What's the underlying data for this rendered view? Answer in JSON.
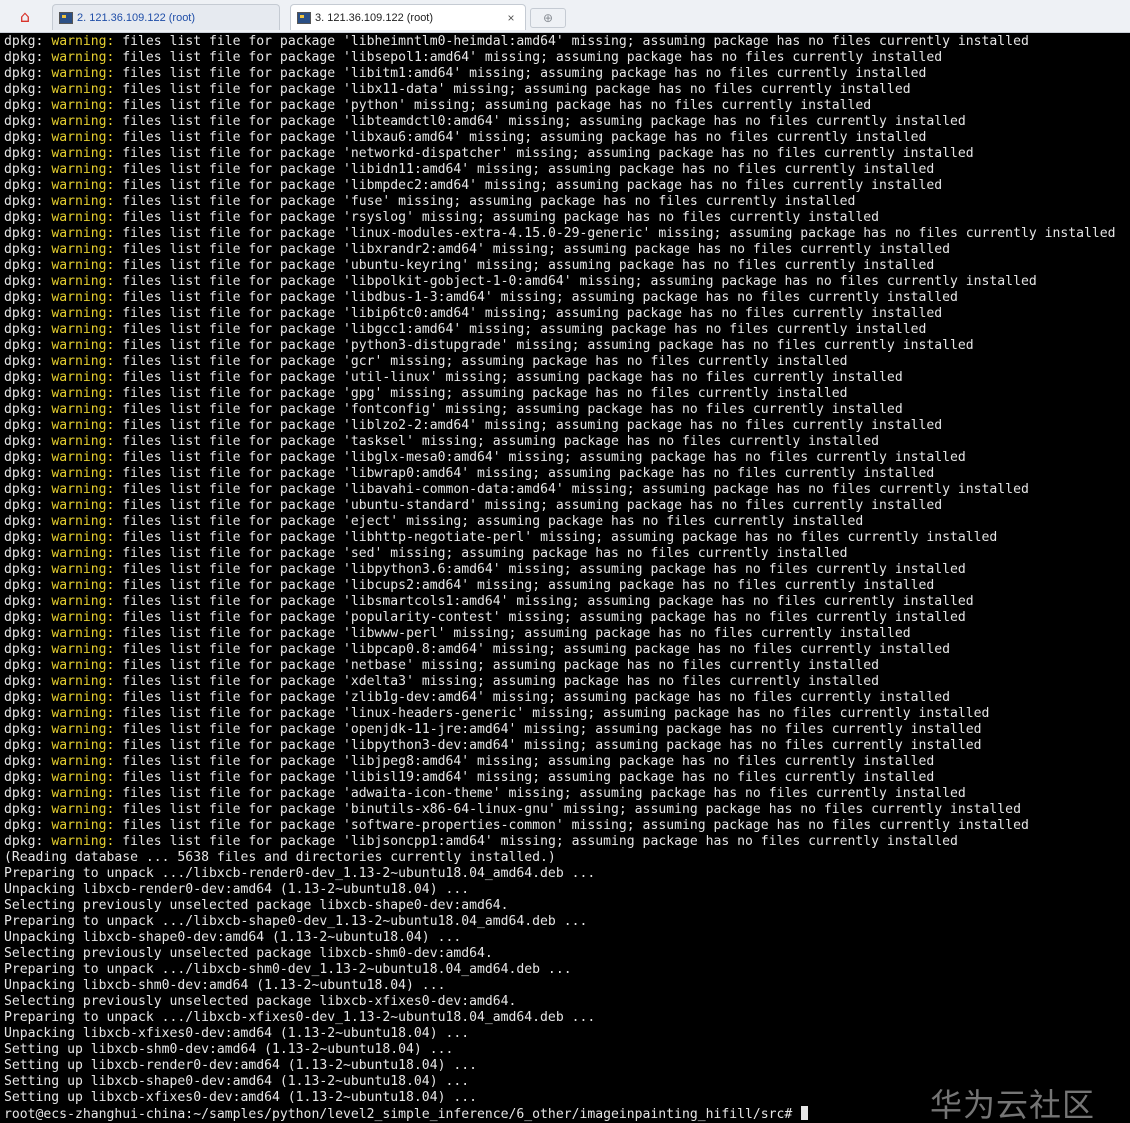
{
  "tabs": [
    {
      "label": "2. 121.36.109.122 (root)"
    },
    {
      "label": "3. 121.36.109.122 (root)",
      "close": "×"
    }
  ],
  "colors": {
    "warning": "#e5cf2f",
    "text": "#e6e6e6",
    "background": "#000000"
  },
  "warning_prefix": "dpkg: ",
  "warning_word": "warning:",
  "warning_lines": [
    " files list file for package 'libheimntlm0-heimdal:amd64' missing; assuming package has no files currently installed",
    " files list file for package 'libsepol1:amd64' missing; assuming package has no files currently installed",
    " files list file for package 'libitm1:amd64' missing; assuming package has no files currently installed",
    " files list file for package 'libx11-data' missing; assuming package has no files currently installed",
    " files list file for package 'python' missing; assuming package has no files currently installed",
    " files list file for package 'libteamdctl0:amd64' missing; assuming package has no files currently installed",
    " files list file for package 'libxau6:amd64' missing; assuming package has no files currently installed",
    " files list file for package 'networkd-dispatcher' missing; assuming package has no files currently installed",
    " files list file for package 'libidn11:amd64' missing; assuming package has no files currently installed",
    " files list file for package 'libmpdec2:amd64' missing; assuming package has no files currently installed",
    " files list file for package 'fuse' missing; assuming package has no files currently installed",
    " files list file for package 'rsyslog' missing; assuming package has no files currently installed",
    " files list file for package 'linux-modules-extra-4.15.0-29-generic' missing; assuming package has no files currently installed",
    " files list file for package 'libxrandr2:amd64' missing; assuming package has no files currently installed",
    " files list file for package 'ubuntu-keyring' missing; assuming package has no files currently installed",
    " files list file for package 'libpolkit-gobject-1-0:amd64' missing; assuming package has no files currently installed",
    " files list file for package 'libdbus-1-3:amd64' missing; assuming package has no files currently installed",
    " files list file for package 'libip6tc0:amd64' missing; assuming package has no files currently installed",
    " files list file for package 'libgcc1:amd64' missing; assuming package has no files currently installed",
    " files list file for package 'python3-distupgrade' missing; assuming package has no files currently installed",
    " files list file for package 'gcr' missing; assuming package has no files currently installed",
    " files list file for package 'util-linux' missing; assuming package has no files currently installed",
    " files list file for package 'gpg' missing; assuming package has no files currently installed",
    " files list file for package 'fontconfig' missing; assuming package has no files currently installed",
    " files list file for package 'liblzo2-2:amd64' missing; assuming package has no files currently installed",
    " files list file for package 'tasksel' missing; assuming package has no files currently installed",
    " files list file for package 'libglx-mesa0:amd64' missing; assuming package has no files currently installed",
    " files list file for package 'libwrap0:amd64' missing; assuming package has no files currently installed",
    " files list file for package 'libavahi-common-data:amd64' missing; assuming package has no files currently installed",
    " files list file for package 'ubuntu-standard' missing; assuming package has no files currently installed",
    " files list file for package 'eject' missing; assuming package has no files currently installed",
    " files list file for package 'libhttp-negotiate-perl' missing; assuming package has no files currently installed",
    " files list file for package 'sed' missing; assuming package has no files currently installed",
    " files list file for package 'libpython3.6:amd64' missing; assuming package has no files currently installed",
    " files list file for package 'libcups2:amd64' missing; assuming package has no files currently installed",
    " files list file for package 'libsmartcols1:amd64' missing; assuming package has no files currently installed",
    " files list file for package 'popularity-contest' missing; assuming package has no files currently installed",
    " files list file for package 'libwww-perl' missing; assuming package has no files currently installed",
    " files list file for package 'libpcap0.8:amd64' missing; assuming package has no files currently installed",
    " files list file for package 'netbase' missing; assuming package has no files currently installed",
    " files list file for package 'xdelta3' missing; assuming package has no files currently installed",
    " files list file for package 'zlib1g-dev:amd64' missing; assuming package has no files currently installed",
    " files list file for package 'linux-headers-generic' missing; assuming package has no files currently installed",
    " files list file for package 'openjdk-11-jre:amd64' missing; assuming package has no files currently installed",
    " files list file for package 'libpython3-dev:amd64' missing; assuming package has no files currently installed",
    " files list file for package 'libjpeg8:amd64' missing; assuming package has no files currently installed",
    " files list file for package 'libisl19:amd64' missing; assuming package has no files currently installed",
    " files list file for package 'adwaita-icon-theme' missing; assuming package has no files currently installed",
    " files list file for package 'binutils-x86-64-linux-gnu' missing; assuming package has no files currently installed",
    " files list file for package 'software-properties-common' missing; assuming package has no files currently installed",
    " files list file for package 'libjsoncpp1:amd64' missing; assuming package has no files currently installed"
  ],
  "plain_lines": [
    "(Reading database ... 5638 files and directories currently installed.)",
    "Preparing to unpack .../libxcb-render0-dev_1.13-2~ubuntu18.04_amd64.deb ...",
    "Unpacking libxcb-render0-dev:amd64 (1.13-2~ubuntu18.04) ...",
    "Selecting previously unselected package libxcb-shape0-dev:amd64.",
    "Preparing to unpack .../libxcb-shape0-dev_1.13-2~ubuntu18.04_amd64.deb ...",
    "Unpacking libxcb-shape0-dev:amd64 (1.13-2~ubuntu18.04) ...",
    "Selecting previously unselected package libxcb-shm0-dev:amd64.",
    "Preparing to unpack .../libxcb-shm0-dev_1.13-2~ubuntu18.04_amd64.deb ...",
    "Unpacking libxcb-shm0-dev:amd64 (1.13-2~ubuntu18.04) ...",
    "Selecting previously unselected package libxcb-xfixes0-dev:amd64.",
    "Preparing to unpack .../libxcb-xfixes0-dev_1.13-2~ubuntu18.04_amd64.deb ...",
    "Unpacking libxcb-xfixes0-dev:amd64 (1.13-2~ubuntu18.04) ...",
    "Setting up libxcb-shm0-dev:amd64 (1.13-2~ubuntu18.04) ...",
    "Setting up libxcb-render0-dev:amd64 (1.13-2~ubuntu18.04) ...",
    "Setting up libxcb-shape0-dev:amd64 (1.13-2~ubuntu18.04) ...",
    "Setting up libxcb-xfixes0-dev:amd64 (1.13-2~ubuntu18.04) ..."
  ],
  "prompt": "root@ecs-zhanghui-china:~/samples/python/level2_simple_inference/6_other/imageinpainting_hifill/src# ",
  "watermark": "华为云社区"
}
